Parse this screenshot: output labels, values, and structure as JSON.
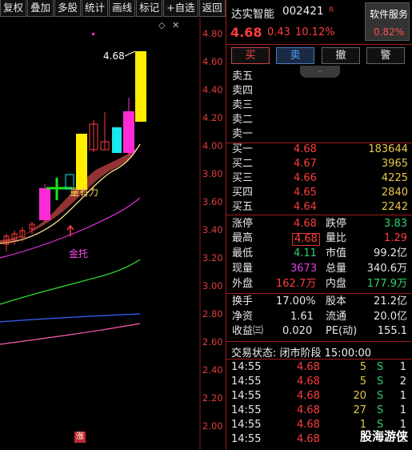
{
  "toolbar": {
    "items": [
      "复权",
      "叠加",
      "多股",
      "统计",
      "画线",
      "标记",
      "+自选",
      "返回"
    ]
  },
  "chart": {
    "icon_diamond": "◇",
    "icon_close": "✕",
    "axis_labels": [
      "4.80",
      "4.60",
      "4.40",
      "4.20",
      "4.00",
      "3.80",
      "3.60",
      "3.40",
      "3.20",
      "3.00",
      "2.80",
      "2.60",
      "2.40",
      "2.20",
      "2.00"
    ],
    "peak_label": "4.68",
    "annotation_yellow": "量有力",
    "annotation_magenta": "金托",
    "limit_badge": "涨",
    "colors": {
      "up": "#ff2bd6",
      "up_alt": "#ffee00",
      "cyan": "#18e8f0",
      "green_cross": "#19e619",
      "band": "#a23a3a"
    }
  },
  "stock": {
    "name": "达实智能",
    "code": "002421",
    "badge": "R",
    "price": "4.68",
    "change": "0.43",
    "change_pct": "10.12%",
    "service_label": "软件服务",
    "service_change": "0.82%"
  },
  "trade_buttons": {
    "buy": "买",
    "sell": "卖",
    "cancel": "撤",
    "alert": "警"
  },
  "fold_icon": "chevron-down",
  "asks": [
    {
      "label": "卖五",
      "price": "",
      "vol": ""
    },
    {
      "label": "卖四",
      "price": "",
      "vol": ""
    },
    {
      "label": "卖三",
      "price": "",
      "vol": ""
    },
    {
      "label": "卖二",
      "price": "",
      "vol": ""
    },
    {
      "label": "卖一",
      "price": "",
      "vol": ""
    }
  ],
  "bids": [
    {
      "label": "买一",
      "price": "4.68",
      "vol": "183644"
    },
    {
      "label": "买二",
      "price": "4.67",
      "vol": "3965"
    },
    {
      "label": "买三",
      "price": "4.66",
      "vol": "4225"
    },
    {
      "label": "买四",
      "price": "4.65",
      "vol": "2840"
    },
    {
      "label": "买五",
      "price": "4.64",
      "vol": "2242"
    }
  ],
  "stats": {
    "limit_up_label": "涨停",
    "limit_up": "4.68",
    "limit_down_label": "跌停",
    "limit_down": "3.83",
    "high_label": "最高",
    "high": "4.68",
    "vol_ratio_label": "量比",
    "vol_ratio": "1.29",
    "low_label": "最低",
    "low": "4.11",
    "mkt_cap_label": "市值",
    "mkt_cap": "99.2亿",
    "current_label": "现量",
    "current": "3673",
    "total_vol_label": "总量",
    "total_vol": "340.6万",
    "outer_label": "外盘",
    "outer": "162.7万",
    "inner_label": "内盘",
    "inner": "177.9万",
    "turnover_label": "换手",
    "turnover": "17.00%",
    "equity_label": "股本",
    "equity": "21.2亿",
    "nav_label": "净资",
    "nav": "1.61",
    "float_label": "流通",
    "float": "20.0亿",
    "eps_label": "收益㈢",
    "eps": "0.020",
    "pe_label": "PE(动)",
    "pe": "155.1"
  },
  "trade_state": "交易状态: 闭市阶段 15:00:00",
  "ticks": [
    {
      "time": "14:55",
      "price": "4.68",
      "vol": "5",
      "side": "S",
      "count": "1"
    },
    {
      "time": "14:55",
      "price": "4.68",
      "vol": "5",
      "side": "S",
      "count": "2"
    },
    {
      "time": "14:55",
      "price": "4.68",
      "vol": "20",
      "side": "S",
      "count": "1"
    },
    {
      "time": "14:55",
      "price": "4.68",
      "vol": "27",
      "side": "S",
      "count": "1"
    },
    {
      "time": "14:55",
      "price": "4.68",
      "vol": "1",
      "side": "S",
      "count": "1"
    },
    {
      "time": "14:55",
      "price": "4.68",
      "vol": "1",
      "side": "S",
      "count": "1"
    }
  ],
  "watermark": "股海游侠"
}
